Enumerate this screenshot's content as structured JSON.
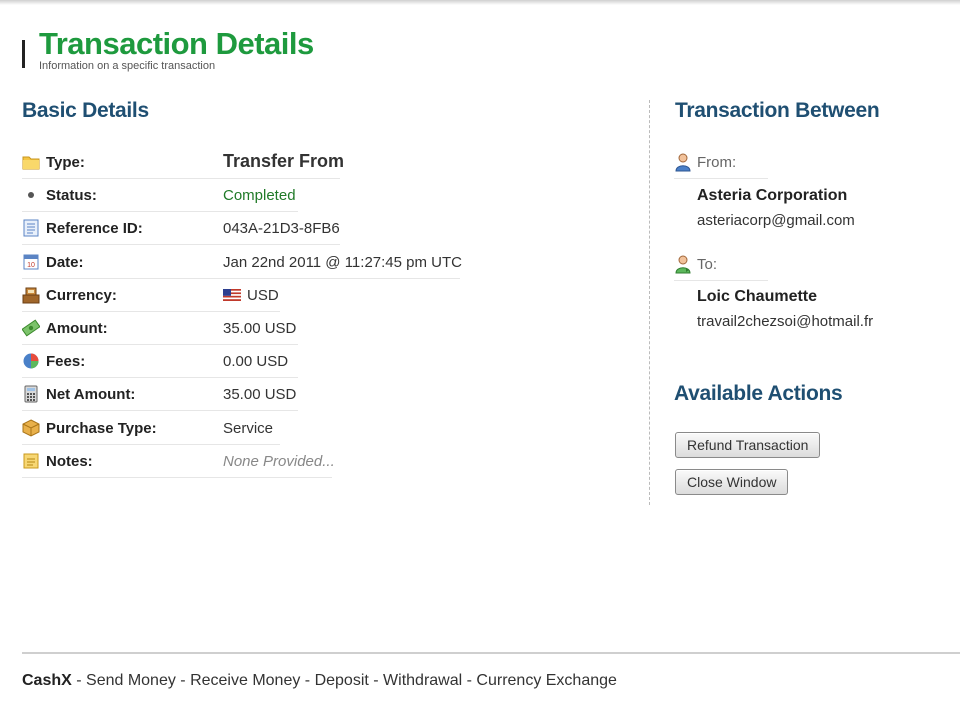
{
  "header": {
    "title": "Transaction Details",
    "subtitle": "Information on a specific transaction"
  },
  "basic_details": {
    "title": "Basic Details",
    "rows": [
      {
        "label": "Type:",
        "value": "Transfer From",
        "icon": "folder-icon"
      },
      {
        "label": "Status:",
        "value": "Completed",
        "icon": "bullet-icon"
      },
      {
        "label": "Reference ID:",
        "value": "043A-21D3-8FB6",
        "icon": "document-icon"
      },
      {
        "label": "Date:",
        "value": "Jan 22nd 2011 @ 11:27:45 pm UTC",
        "icon": "calendar-icon"
      },
      {
        "label": "Currency:",
        "value": "USD",
        "icon": "cash-register-icon",
        "value_icon": "us-flag-icon"
      },
      {
        "label": "Amount:",
        "value": "35.00 USD",
        "icon": "money-icon"
      },
      {
        "label": "Fees:",
        "value": "0.00 USD",
        "icon": "pie-chart-icon"
      },
      {
        "label": "Net Amount:",
        "value": "35.00 USD",
        "icon": "calculator-icon"
      },
      {
        "label": "Purchase Type:",
        "value": "Service",
        "icon": "package-icon"
      },
      {
        "label": "Notes:",
        "value": "None Provided...",
        "icon": "note-icon"
      }
    ]
  },
  "transaction_between": {
    "title": "Transaction Between",
    "from": {
      "label": "From:",
      "name": "Asteria Corporation",
      "email": "asteriacorp@gmail.com",
      "icon": "user-icon"
    },
    "to": {
      "label": "To:",
      "name": "Loic Chaumette",
      "email": "travail2chezsoi@hotmail.fr",
      "icon": "user-green-icon"
    }
  },
  "actions": {
    "title": "Available Actions",
    "refund_label": "Refund Transaction",
    "close_label": "Close Window"
  },
  "footer": {
    "brand": "CashX",
    "separator": " - ",
    "links": [
      "Send Money",
      "Receive Money",
      "Deposit",
      "Withdrawal",
      "Currency Exchange"
    ]
  },
  "colors": {
    "title_green": "#1e9a3e",
    "section_blue": "#1f4f72",
    "status_green": "#207a28"
  }
}
